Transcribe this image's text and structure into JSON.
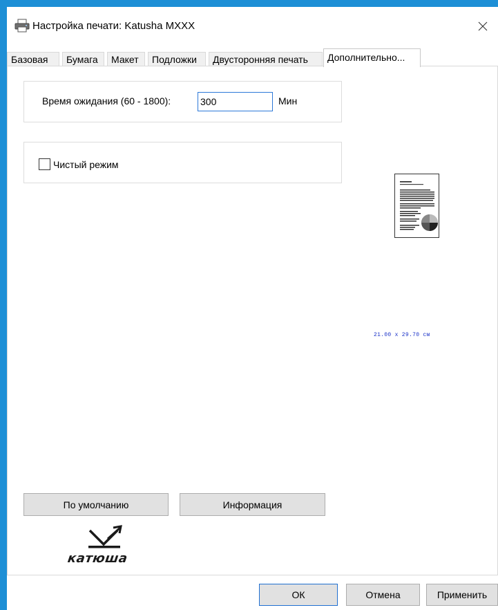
{
  "window": {
    "title": "Настройка печати: Katusha MXXX"
  },
  "icons": {
    "app": "printer-icon",
    "close": "close-icon",
    "checkbox": "checkbox-icon"
  },
  "tabs": [
    {
      "label": "Базовая",
      "active": false
    },
    {
      "label": "Бумага",
      "active": false
    },
    {
      "label": "Макет",
      "active": false
    },
    {
      "label": "Подложки",
      "active": false
    },
    {
      "label": "Двусторонняя печать",
      "active": false
    },
    {
      "label": "Дополнительно...",
      "active": true
    }
  ],
  "timeout": {
    "label": "Время ожидания (60 - 1800):",
    "value": "300",
    "unit": "Мин"
  },
  "clean_mode": {
    "label": "Чистый режим",
    "checked": false
  },
  "preview": {
    "paper_size": "21.00 x 29.70 см"
  },
  "buttons": {
    "defaults": "По умолчанию",
    "info": "Информация",
    "ok": "ОК",
    "cancel": "Отмена",
    "apply": "Применить"
  },
  "logo": {
    "text": "катюша"
  },
  "colors": {
    "accent": "#1d8fd6",
    "focus": "#2b78d8",
    "button_bg": "#e1e1e1",
    "paper_size_text": "#1a32c8"
  }
}
